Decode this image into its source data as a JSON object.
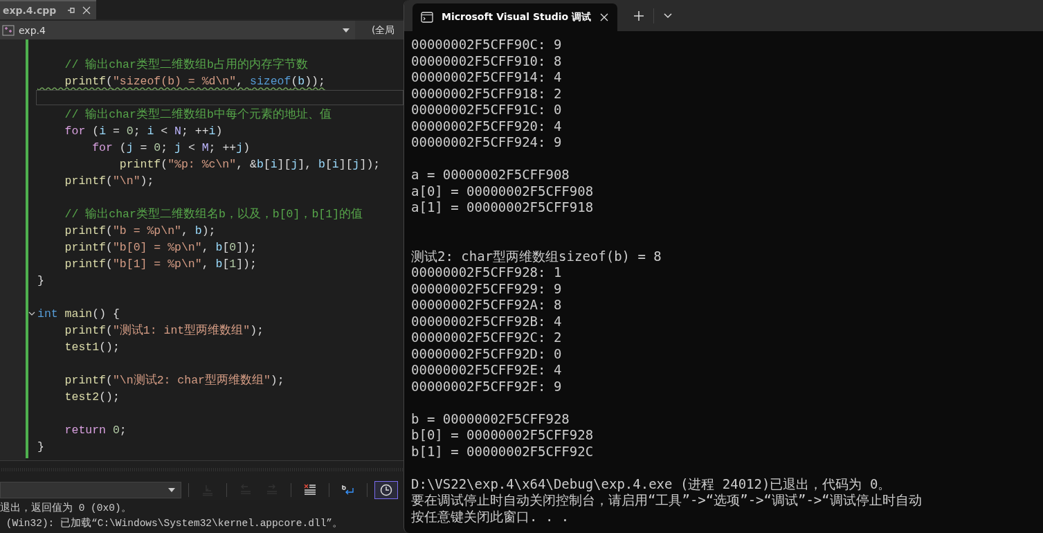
{
  "editor_tab": {
    "title": "exp.4.cpp"
  },
  "nav_bar": {
    "project": "exp.4",
    "scope": "(全局"
  },
  "code_lines": [
    {
      "kind": "code",
      "squiggle": false,
      "fold": false,
      "tokens": [
        {
          "kind": "cm",
          "text": "    // 输出char类型二维数组b占用的内存字节数"
        }
      ]
    },
    {
      "kind": "code",
      "squiggle": true,
      "fold": false,
      "tokens": [
        {
          "kind": "fn",
          "text": "    printf"
        },
        {
          "kind": "pl",
          "text": "("
        },
        {
          "kind": "str",
          "text": "\"sizeof(b) = %d\\n\""
        },
        {
          "kind": "pl",
          "text": ", "
        },
        {
          "kind": "ty",
          "text": "sizeof"
        },
        {
          "kind": "pl",
          "text": "("
        },
        {
          "kind": "id",
          "text": "b"
        },
        {
          "kind": "pl",
          "text": "));"
        }
      ]
    },
    {
      "kind": "current"
    },
    {
      "kind": "code",
      "squiggle": false,
      "fold": false,
      "tokens": [
        {
          "kind": "cm",
          "text": "    // 输出char类型二维数组b中每个元素的地址、值"
        }
      ]
    },
    {
      "kind": "code",
      "squiggle": false,
      "fold": false,
      "tokens": [
        {
          "kind": "kw",
          "text": "    for"
        },
        {
          "kind": "pl",
          "text": " ("
        },
        {
          "kind": "id",
          "text": "i"
        },
        {
          "kind": "pl",
          "text": " = "
        },
        {
          "kind": "num",
          "text": "0"
        },
        {
          "kind": "pl",
          "text": "; "
        },
        {
          "kind": "id",
          "text": "i"
        },
        {
          "kind": "pl",
          "text": " < "
        },
        {
          "kind": "mac",
          "text": "N"
        },
        {
          "kind": "pl",
          "text": "; ++"
        },
        {
          "kind": "id",
          "text": "i"
        },
        {
          "kind": "pl",
          "text": ")"
        }
      ]
    },
    {
      "kind": "code",
      "squiggle": false,
      "fold": false,
      "tokens": [
        {
          "kind": "kw",
          "text": "        for"
        },
        {
          "kind": "pl",
          "text": " ("
        },
        {
          "kind": "id",
          "text": "j"
        },
        {
          "kind": "pl",
          "text": " = "
        },
        {
          "kind": "num",
          "text": "0"
        },
        {
          "kind": "pl",
          "text": "; "
        },
        {
          "kind": "id",
          "text": "j"
        },
        {
          "kind": "pl",
          "text": " < "
        },
        {
          "kind": "mac",
          "text": "M"
        },
        {
          "kind": "pl",
          "text": "; ++"
        },
        {
          "kind": "id",
          "text": "j"
        },
        {
          "kind": "pl",
          "text": ")"
        }
      ]
    },
    {
      "kind": "code",
      "squiggle": false,
      "fold": false,
      "tokens": [
        {
          "kind": "fn",
          "text": "            printf"
        },
        {
          "kind": "pl",
          "text": "("
        },
        {
          "kind": "str",
          "text": "\"%p: %c\\n\""
        },
        {
          "kind": "pl",
          "text": ", &"
        },
        {
          "kind": "id",
          "text": "b"
        },
        {
          "kind": "pl",
          "text": "["
        },
        {
          "kind": "id",
          "text": "i"
        },
        {
          "kind": "pl",
          "text": "]["
        },
        {
          "kind": "id",
          "text": "j"
        },
        {
          "kind": "pl",
          "text": "], "
        },
        {
          "kind": "id",
          "text": "b"
        },
        {
          "kind": "pl",
          "text": "["
        },
        {
          "kind": "id",
          "text": "i"
        },
        {
          "kind": "pl",
          "text": "]["
        },
        {
          "kind": "id",
          "text": "j"
        },
        {
          "kind": "pl",
          "text": "]);"
        }
      ]
    },
    {
      "kind": "code",
      "squiggle": false,
      "fold": false,
      "tokens": [
        {
          "kind": "fn",
          "text": "    printf"
        },
        {
          "kind": "pl",
          "text": "("
        },
        {
          "kind": "str",
          "text": "\"\\n\""
        },
        {
          "kind": "pl",
          "text": ");"
        }
      ]
    },
    {
      "kind": "blank"
    },
    {
      "kind": "code",
      "squiggle": false,
      "fold": false,
      "tokens": [
        {
          "kind": "cm",
          "text": "    // 输出char类型二维数组名b，以及，b[0]，b[1]的值"
        }
      ]
    },
    {
      "kind": "code",
      "squiggle": false,
      "fold": false,
      "tokens": [
        {
          "kind": "fn",
          "text": "    printf"
        },
        {
          "kind": "pl",
          "text": "("
        },
        {
          "kind": "str",
          "text": "\"b = %p\\n\""
        },
        {
          "kind": "pl",
          "text": ", "
        },
        {
          "kind": "id",
          "text": "b"
        },
        {
          "kind": "pl",
          "text": ");"
        }
      ]
    },
    {
      "kind": "code",
      "squiggle": false,
      "fold": false,
      "tokens": [
        {
          "kind": "fn",
          "text": "    printf"
        },
        {
          "kind": "pl",
          "text": "("
        },
        {
          "kind": "str",
          "text": "\"b[0] = %p\\n\""
        },
        {
          "kind": "pl",
          "text": ", "
        },
        {
          "kind": "id",
          "text": "b"
        },
        {
          "kind": "pl",
          "text": "["
        },
        {
          "kind": "num",
          "text": "0"
        },
        {
          "kind": "pl",
          "text": "]);"
        }
      ]
    },
    {
      "kind": "code",
      "squiggle": false,
      "fold": false,
      "tokens": [
        {
          "kind": "fn",
          "text": "    printf"
        },
        {
          "kind": "pl",
          "text": "("
        },
        {
          "kind": "str",
          "text": "\"b[1] = %p\\n\""
        },
        {
          "kind": "pl",
          "text": ", "
        },
        {
          "kind": "id",
          "text": "b"
        },
        {
          "kind": "pl",
          "text": "["
        },
        {
          "kind": "num",
          "text": "1"
        },
        {
          "kind": "pl",
          "text": "]);"
        }
      ]
    },
    {
      "kind": "code",
      "squiggle": false,
      "fold": false,
      "tokens": [
        {
          "kind": "pl",
          "text": "}"
        }
      ]
    },
    {
      "kind": "blank"
    },
    {
      "kind": "code",
      "squiggle": false,
      "fold": true,
      "tokens": [
        {
          "kind": "ty",
          "text": "int"
        },
        {
          "kind": "fn",
          "text": " main"
        },
        {
          "kind": "pl",
          "text": "() {"
        }
      ]
    },
    {
      "kind": "code",
      "squiggle": false,
      "fold": false,
      "tokens": [
        {
          "kind": "fn",
          "text": "    printf"
        },
        {
          "kind": "pl",
          "text": "("
        },
        {
          "kind": "str",
          "text": "\"测试1: int型两维数组\""
        },
        {
          "kind": "pl",
          "text": ");"
        }
      ]
    },
    {
      "kind": "code",
      "squiggle": false,
      "fold": false,
      "tokens": [
        {
          "kind": "fn",
          "text": "    test1"
        },
        {
          "kind": "pl",
          "text": "();"
        }
      ]
    },
    {
      "kind": "blank"
    },
    {
      "kind": "code",
      "squiggle": false,
      "fold": false,
      "tokens": [
        {
          "kind": "fn",
          "text": "    printf"
        },
        {
          "kind": "pl",
          "text": "("
        },
        {
          "kind": "str",
          "text": "\"\\n测试2: char型两维数组\""
        },
        {
          "kind": "pl",
          "text": ");"
        }
      ]
    },
    {
      "kind": "code",
      "squiggle": false,
      "fold": false,
      "tokens": [
        {
          "kind": "fn",
          "text": "    test2"
        },
        {
          "kind": "pl",
          "text": "();"
        }
      ]
    },
    {
      "kind": "blank"
    },
    {
      "kind": "code",
      "squiggle": false,
      "fold": false,
      "tokens": [
        {
          "kind": "kw",
          "text": "    return"
        },
        {
          "kind": "num",
          "text": " 0"
        },
        {
          "kind": "pl",
          "text": ";"
        }
      ]
    },
    {
      "kind": "code",
      "squiggle": false,
      "fold": false,
      "tokens": [
        {
          "kind": "pl",
          "text": "}"
        }
      ]
    }
  ],
  "output_toolbar": {
    "buttons": [
      {
        "kind": "goto",
        "disabled": true,
        "selected": false
      },
      {
        "kind": "prev",
        "disabled": true,
        "selected": false
      },
      {
        "kind": "next",
        "disabled": true,
        "selected": false
      },
      {
        "kind": "clear",
        "disabled": false,
        "selected": false
      },
      {
        "kind": "wrap",
        "disabled": false,
        "selected": false
      },
      {
        "kind": "clock",
        "disabled": false,
        "selected": true
      }
    ]
  },
  "output_lines": [
    "退出，返回值为 0 (0x0)。",
    " (Win32): 已加载“C:\\Windows\\System32\\kernel.appcore.dll”。"
  ],
  "terminal": {
    "tab_title": "Microsoft Visual Studio 调试",
    "lines": [
      {
        "kind": "text",
        "text": "00000002F5CFF90C: 9"
      },
      {
        "kind": "text",
        "text": "00000002F5CFF910: 8"
      },
      {
        "kind": "text",
        "text": "00000002F5CFF914: 4"
      },
      {
        "kind": "text",
        "text": "00000002F5CFF918: 2"
      },
      {
        "kind": "text",
        "text": "00000002F5CFF91C: 0"
      },
      {
        "kind": "text",
        "text": "00000002F5CFF920: 4"
      },
      {
        "kind": "text",
        "text": "00000002F5CFF924: 9"
      },
      {
        "kind": "blank"
      },
      {
        "kind": "text",
        "text": "a = 00000002F5CFF908"
      },
      {
        "kind": "text",
        "text": "a[0] = 00000002F5CFF908"
      },
      {
        "kind": "text",
        "text": "a[1] = 00000002F5CFF918"
      },
      {
        "kind": "blank"
      },
      {
        "kind": "blank"
      },
      {
        "kind": "text",
        "text": "测试2: char型两维数组sizeof(b) = 8"
      },
      {
        "kind": "text",
        "text": "00000002F5CFF928: 1"
      },
      {
        "kind": "text",
        "text": "00000002F5CFF929: 9"
      },
      {
        "kind": "text",
        "text": "00000002F5CFF92A: 8"
      },
      {
        "kind": "text",
        "text": "00000002F5CFF92B: 4"
      },
      {
        "kind": "text",
        "text": "00000002F5CFF92C: 2"
      },
      {
        "kind": "text",
        "text": "00000002F5CFF92D: 0"
      },
      {
        "kind": "text",
        "text": "00000002F5CFF92E: 4"
      },
      {
        "kind": "text",
        "text": "00000002F5CFF92F: 9"
      },
      {
        "kind": "blank"
      },
      {
        "kind": "text",
        "text": "b = 00000002F5CFF928"
      },
      {
        "kind": "text",
        "text": "b[0] = 00000002F5CFF928"
      },
      {
        "kind": "text",
        "text": "b[1] = 00000002F5CFF92C"
      },
      {
        "kind": "blank"
      },
      {
        "kind": "text",
        "text": "D:\\VS22\\exp.4\\x64\\Debug\\exp.4.exe (进程 24012)已退出，代码为 0。"
      },
      {
        "kind": "text",
        "text": "要在调试停止时自动关闭控制台，请启用“工具”->“选项”->“调试”->“调试停止时自动"
      },
      {
        "kind": "text",
        "text": "按任意键关闭此窗口. . ."
      }
    ]
  }
}
